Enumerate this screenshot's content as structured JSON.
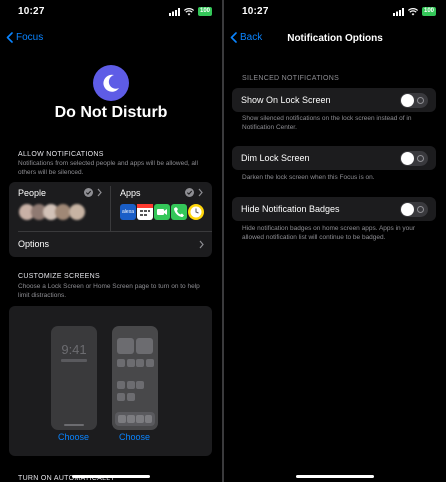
{
  "status_bar": {
    "time": "10:27",
    "battery": "100"
  },
  "left": {
    "nav": {
      "back_label": "Focus"
    },
    "title": "Do Not Disturb",
    "allow": {
      "header": "ALLOW NOTIFICATIONS",
      "description": "Notifications from selected people and apps will be allowed, all others will be silenced.",
      "people_label": "People",
      "apps_label": "Apps",
      "options_label": "Options",
      "alexa_label": "alexa"
    },
    "customize": {
      "header": "CUSTOMIZE SCREENS",
      "description": "Choose a Lock Screen or Home Screen page to turn on to help limit distractions.",
      "lock_time": "9:41",
      "choose_lock": "Choose",
      "choose_home": "Choose"
    },
    "turn_on_header": "TURN ON AUTOMATICALLY"
  },
  "right": {
    "nav": {
      "back_label": "Back",
      "title": "Notification Options"
    },
    "section_header": "SILENCED NOTIFICATIONS",
    "options": [
      {
        "label": "Show On Lock Screen",
        "description": "Show silenced notifications on the lock screen instead of in Notification Center.",
        "on": false
      },
      {
        "label": "Dim Lock Screen",
        "description": "Darken the lock screen when this Focus is on.",
        "on": false
      },
      {
        "label": "Hide Notification Badges",
        "description": "Hide notification badges on home screen apps. Apps in your allowed notification list will continue to be badged.",
        "on": false
      }
    ]
  },
  "colors": {
    "accent": "#0a84ff",
    "focus_purple": "#5e5ce6",
    "cell": "#1c1c1e",
    "battery": "#34c759"
  }
}
